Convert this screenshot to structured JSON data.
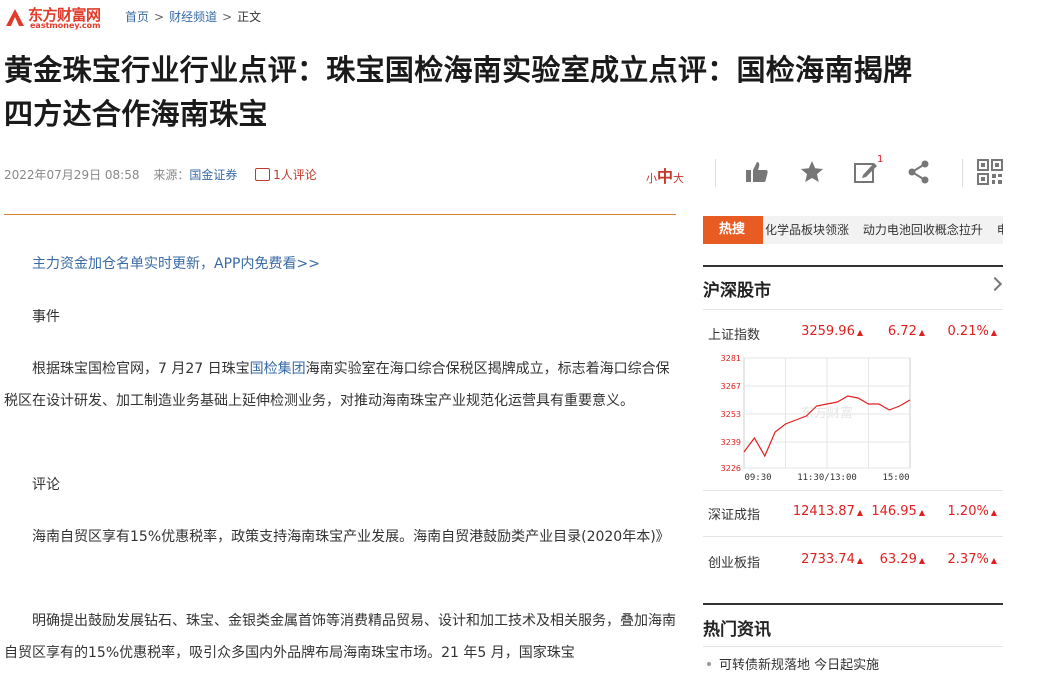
{
  "header": {
    "logo_text": "东方财富网",
    "logo_sub": "eastmoney.com",
    "breadcrumb": [
      "首页",
      "财经频道",
      "正文"
    ]
  },
  "article": {
    "title_line1": "黄金珠宝行业行业点评：珠宝国检海南实验室成立点评：国检海南揭牌",
    "title_line2": "四方达合作海南珠宝",
    "date": "2022年07月29日 08:58",
    "source_label": "来源：",
    "source": "国金证券",
    "comment_count": "1人评论",
    "font_small": "小",
    "font_mid": "中",
    "font_large": "大",
    "edit_badge": "1",
    "promo_link": "主力资金加仓名单实时更新，APP内免费看>>",
    "p_event": "事件",
    "p1_before": "根据珠宝国检官网，7 月27 日珠宝",
    "p1_link": "国检集团",
    "p1_after": "海南实验室在海口综合保税区揭牌成立，标志着海口综合保税区在设计研发、加工制造业务基础上延伸检测业务，对推动海南珠宝产业规范化运营具有重要意义。",
    "p_comment": "评论",
    "p2": "海南自贸区享有15%优惠税率，政策支持海南珠宝产业发展。海南自贸港鼓励类产业目录(2020年本)》",
    "p3": "明确提出鼓励发展钻石、珠宝、金银类金属首饰等消费精品贸易、设计和加工技术及相关服务，叠加海南自贸区享有的15%优惠税率，吸引众多国内外品牌布局海南珠宝市场。21 年5 月，国家珠宝"
  },
  "sidebar": {
    "hot_label": "热搜",
    "hot_items": [
      "化学品板块领涨",
      "动力电池回收概念拉升",
      "电"
    ],
    "market_title": "沪深股市",
    "indices": [
      {
        "name": "上证指数",
        "value": "3259.96",
        "change": "6.72",
        "pct": "0.21%"
      },
      {
        "name": "深证成指",
        "value": "12413.87",
        "change": "146.95",
        "pct": "1.20%"
      },
      {
        "name": "创业板指",
        "value": "2733.74",
        "change": "63.29",
        "pct": "2.37%"
      }
    ],
    "up_arrow": "▲",
    "chart_yticks": [
      "3281",
      "3267",
      "3253",
      "3239",
      "3226"
    ],
    "chart_xticks": [
      "09:30",
      "11:30/13:00",
      "15:00"
    ],
    "chart_watermark": "东方财富",
    "news_title": "热门资讯",
    "news_items": [
      "可转债新规落地 今日起实施"
    ]
  },
  "chart_data": {
    "type": "line",
    "title": "",
    "xlabel": "",
    "ylabel": "",
    "x": [
      "09:30",
      "09:45",
      "10:00",
      "10:15",
      "10:30",
      "10:45",
      "11:00",
      "11:15",
      "11:30/13:00",
      "13:15",
      "13:30",
      "13:45",
      "14:00",
      "14:15",
      "14:30",
      "14:45",
      "15:00"
    ],
    "series": [
      {
        "values": [
          3234,
          3241,
          3232,
          3244,
          3248,
          3250,
          3252,
          3257,
          3258,
          3259,
          3262,
          3261,
          3258,
          3258,
          3255,
          3257,
          3260
        ]
      }
    ],
    "ylim": [
      3226,
      3281
    ],
    "yticks": [
      3226,
      3239,
      3253,
      3267,
      3281
    ],
    "grid": true,
    "line_color": "#e02020"
  },
  "colors": {
    "accent": "#e85b22",
    "up": "#e02020",
    "link": "#3a6ba5"
  }
}
